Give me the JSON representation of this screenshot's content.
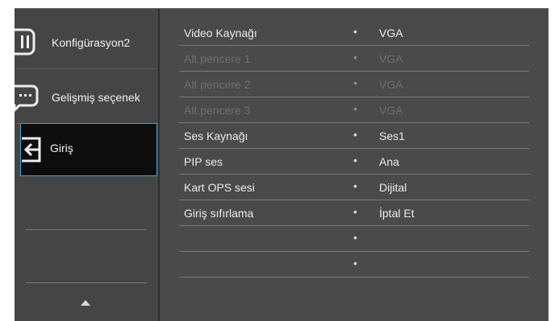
{
  "sidebar": {
    "items": [
      {
        "label": "Konfigürasyon2",
        "icon": "config-icon",
        "selected": false
      },
      {
        "label": "Gelişmiş seçenek",
        "icon": "more-options-icon",
        "selected": false
      },
      {
        "label": "Giriş",
        "icon": "input-icon",
        "selected": true
      }
    ],
    "scroll_up_icon": "up-arrow-icon"
  },
  "menu": {
    "rows": [
      {
        "name": "Video Kaynağı",
        "value": "VGA",
        "enabled": true
      },
      {
        "name": "Alt pencere 1",
        "value": "VGA",
        "enabled": false
      },
      {
        "name": "Alt pencere 2",
        "value": "VGA",
        "enabled": false
      },
      {
        "name": "Alt pencere 3",
        "value": "VGA",
        "enabled": false
      },
      {
        "name": "Ses Kaynağı",
        "value": "Ses1",
        "enabled": true
      },
      {
        "name": "PIP ses",
        "value": "Ana",
        "enabled": true
      },
      {
        "name": "Kart OPS sesi",
        "value": "Dijital",
        "enabled": true
      },
      {
        "name": "Giriş sıfırlama",
        "value": "İptal Et",
        "enabled": true
      },
      {
        "name": "",
        "value": "",
        "enabled": true
      },
      {
        "name": "",
        "value": "",
        "enabled": true
      }
    ],
    "bullet": "•"
  },
  "colors": {
    "selection_border": "#4a9fe0",
    "selected_bg": "#0d0d0d",
    "panel_bg": "#4a4a4a"
  }
}
